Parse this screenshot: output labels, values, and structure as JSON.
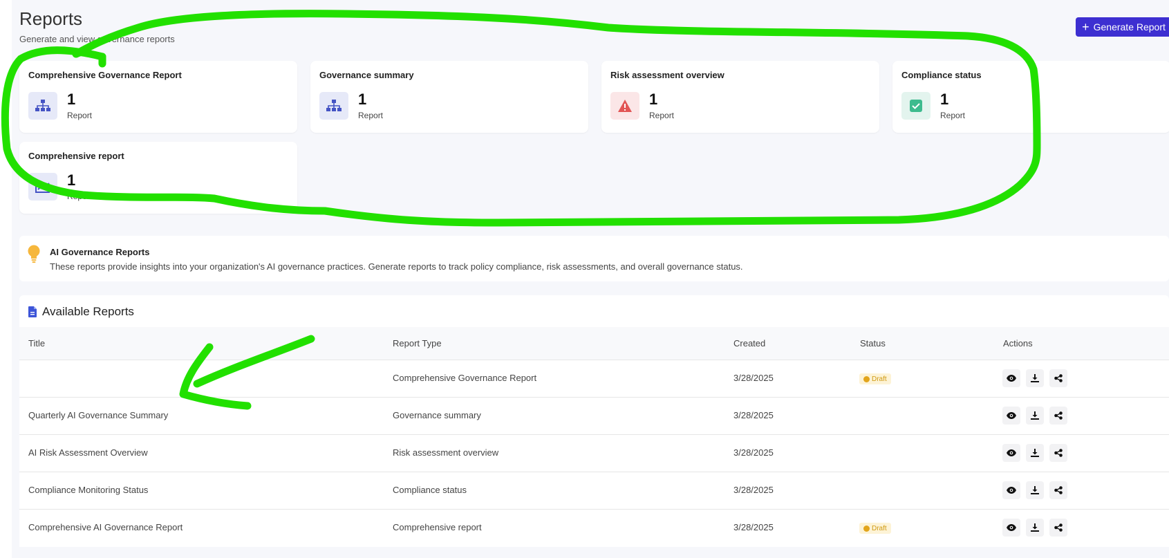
{
  "header": {
    "title": "Reports",
    "subtitle": "Generate and view governance reports",
    "generate_button": "Generate Report"
  },
  "summary_cards": [
    {
      "title": "Comprehensive Governance Report",
      "count": "1",
      "unit": "Report",
      "icon": "sitemap-icon",
      "icon_color": "#4453c4",
      "icon_bg": "#e6e9f8"
    },
    {
      "title": "Governance summary",
      "count": "1",
      "unit": "Report",
      "icon": "sitemap-icon",
      "icon_color": "#4453c4",
      "icon_bg": "#e6e9f8"
    },
    {
      "title": "Risk assessment overview",
      "count": "1",
      "unit": "Report",
      "icon": "warning-icon",
      "icon_color": "#e25555",
      "icon_bg": "#fbe6e7"
    },
    {
      "title": "Compliance status",
      "count": "1",
      "unit": "Report",
      "icon": "check-square-icon",
      "icon_color": "#3dbb8e",
      "icon_bg": "#e3f4ee"
    },
    {
      "title": "Comprehensive report",
      "count": "1",
      "unit": "Report",
      "icon": "line-chart-icon",
      "icon_color": "#4453c4",
      "icon_bg": "#e6e9f8"
    }
  ],
  "info_banner": {
    "title": "AI Governance Reports",
    "text": "These reports provide insights into your organization's AI governance practices. Generate reports to track policy compliance, risk assessments, and overall governance status.",
    "icon": "lightbulb-icon"
  },
  "available_reports": {
    "heading": "Available Reports",
    "columns": [
      "Title",
      "Report Type",
      "Created",
      "Status",
      "Actions"
    ],
    "rows": [
      {
        "title": "",
        "type": "Comprehensive Governance Report",
        "created": "3/28/2025",
        "status": "Draft"
      },
      {
        "title": "Quarterly AI Governance Summary",
        "type": "Governance summary",
        "created": "3/28/2025",
        "status": ""
      },
      {
        "title": "AI Risk Assessment Overview",
        "type": "Risk assessment overview",
        "created": "3/28/2025",
        "status": ""
      },
      {
        "title": "Compliance Monitoring Status",
        "type": "Compliance status",
        "created": "3/28/2025",
        "status": ""
      },
      {
        "title": "Comprehensive AI Governance Report",
        "type": "Comprehensive report",
        "created": "3/28/2025",
        "status": "Draft"
      }
    ],
    "action_icons": [
      "eye-icon",
      "download-icon",
      "share-icon"
    ]
  },
  "annotation_color": "#22e000",
  "accent_color": "#3d2fd1"
}
